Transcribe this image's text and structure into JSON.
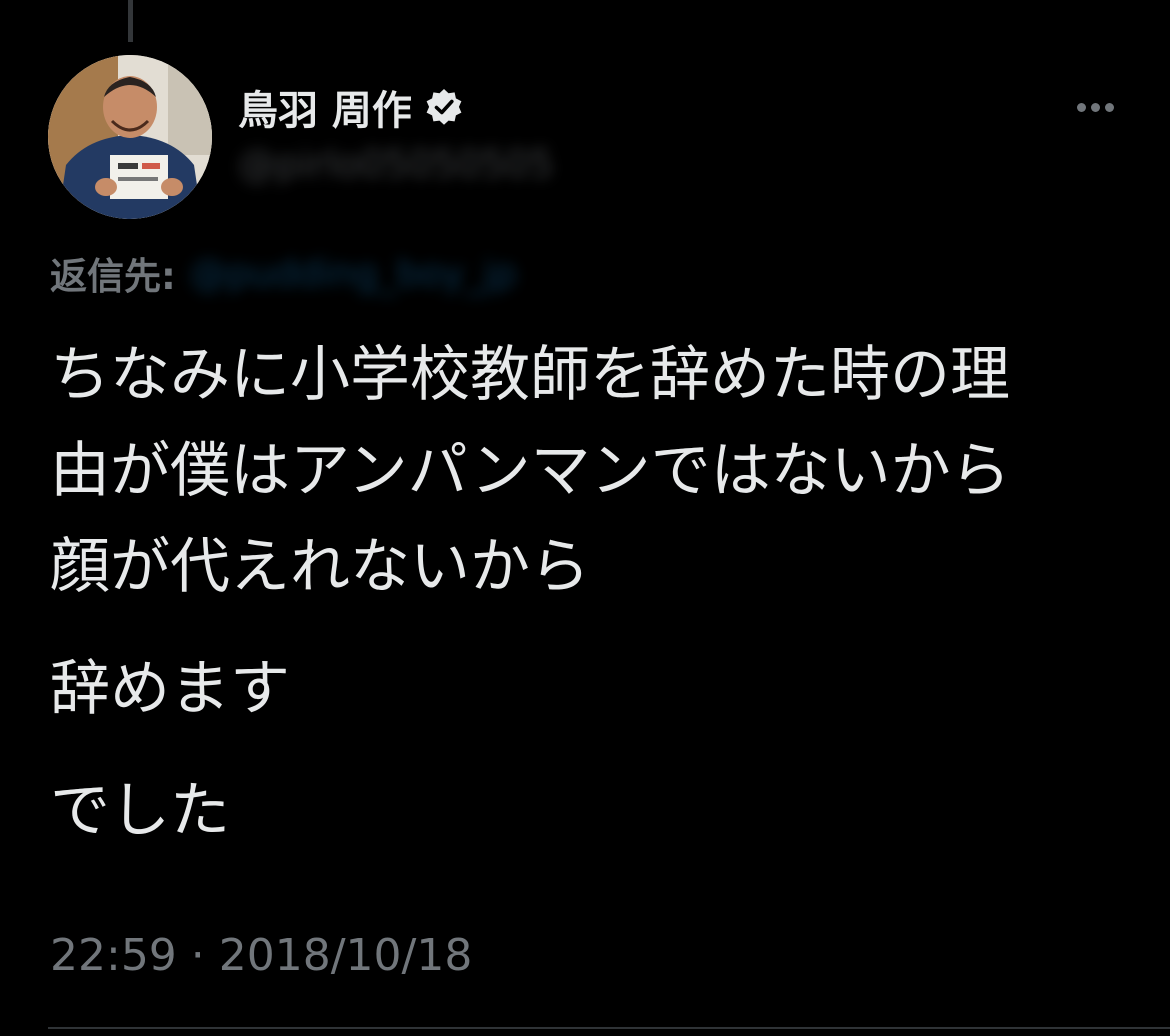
{
  "tweet": {
    "author": {
      "display_name": "鳥羽 周作",
      "handle": "@pirlo05050505",
      "verified_icon": "verified-badge-icon",
      "avatar_icon": "profile-photo"
    },
    "more_icon": "more-horizontal-icon",
    "reply_label": "返信先:",
    "reply_target": "@pudding_boy_jp",
    "text": {
      "line_1": "ちなみに小学校教師を辞めた時の理",
      "line_2": "由が僕はアンパンマンではないから",
      "line_3": "顔が代えれないから",
      "line_4": "辞めます",
      "line_5": "でした"
    },
    "timestamp": "22:59 · 2018/10/18"
  },
  "colors": {
    "background": "#000000",
    "text_primary": "#e7e9ea",
    "text_secondary": "#71767b",
    "link": "#1d9bf0",
    "divider": "#2f3336"
  }
}
